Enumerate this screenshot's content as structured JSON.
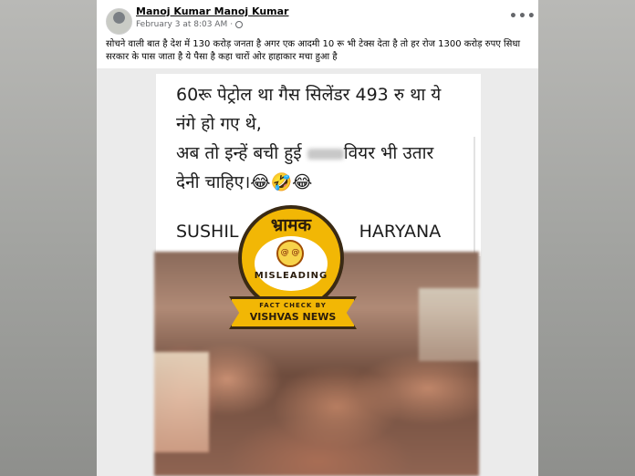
{
  "post": {
    "author": "Manoj Kumar Manoj Kumar",
    "timestamp": "February 3 at 8:03 AM",
    "separator": "·",
    "privacy_icon": "globe-icon",
    "more_icon": "more-options-icon",
    "text": "सोचने वाली बात है देश में 130 करोड़ जनता है अगर एक आदमी 10 रू भी टेक्स देता है तो हर रोज 1300 करोड़ रुपए सिधा सरकार के पास जाता है ये पैसा है कहा चारों ओर हाहाकार मचा हुआ है"
  },
  "embed": {
    "line1": "60रू पेट्रोल था गैस सिलेंडर 493 रु था ये",
    "line2": "नंगे हो गए थे,",
    "line3_pre": "अब तो इन्हें बची हुई",
    "line3_post": "वियर भी उतार",
    "line4": "देनी चाहिए।😂🤣😂",
    "line5_pre": "SUSHIL",
    "line5_post": "HARYANA"
  },
  "badge": {
    "title": "भ्रामक",
    "verdict": "MISLEADING",
    "ribbon_small": "FACT CHECK BY",
    "ribbon_big": "VISHVAS NEWS",
    "accent_color": "#f2b705"
  }
}
